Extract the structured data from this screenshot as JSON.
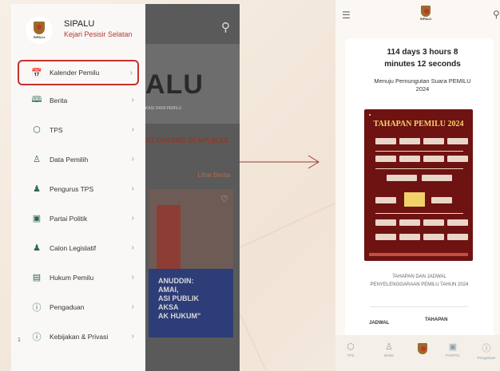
{
  "left_phone": {
    "drawer": {
      "app_name": "SIPALU",
      "subtitle": "Kejari Pesisir Selatan",
      "logo_caption": "SIPALU",
      "items": [
        {
          "label": "Kalender Pemilu",
          "icon": "calendar-icon",
          "glyph": "📅",
          "active": true
        },
        {
          "label": "Berita",
          "icon": "book-icon",
          "glyph": "🕮",
          "active": false
        },
        {
          "label": "TPS",
          "icon": "box-icon",
          "glyph": "⬡",
          "active": false
        },
        {
          "label": "Data Pemilih",
          "icon": "user-icon",
          "glyph": "♙",
          "active": false
        },
        {
          "label": "Pengurus TPS",
          "icon": "person-icon",
          "glyph": "♟",
          "active": false
        },
        {
          "label": "Partai Politik",
          "icon": "portrait-icon",
          "glyph": "▣",
          "active": false
        },
        {
          "label": "Calon Legislatif",
          "icon": "candidate-icon",
          "glyph": "♟",
          "active": false
        },
        {
          "label": "Hukum Pemilu",
          "icon": "law-icon",
          "glyph": "▤",
          "active": false
        },
        {
          "label": "Pengaduan",
          "icon": "shield-icon",
          "glyph": "ⓘ",
          "active": false
        },
        {
          "label": "Kebijakan & Privasi",
          "icon": "privacy-icon",
          "glyph": "ⓘ",
          "active": false
        }
      ]
    },
    "background": {
      "banner_text": "ALU",
      "banner_sub": "KASI DATA PEMILU",
      "welcome": "AT DATANG DI APLIKAS",
      "see_all": "Lihat Berita",
      "quote": "ANUDDIN:\nAMAI,\nASI PUBLIK\nAKSA\nAK HUKUM\"",
      "footer": "1"
    }
  },
  "right_phone": {
    "logo_caption": "SIPALU",
    "countdown": "114 days 3 hours 8 minutes 12 seconds",
    "countdown_desc": "Menuju Pemungutan Suara PEMILU 2024",
    "poster_title": "TAHAPAN PEMILU 2024",
    "poster_caption": "TAHAPAN DAN JADWAL PENYELENGGARAAN PEMILU TAHUN 2024",
    "tab_schedule": "JADWAL",
    "tab_stages": "TAHAPAN",
    "nav": [
      {
        "label": "TPS",
        "icon": "box-icon",
        "glyph": "⬡"
      },
      {
        "label": "Berita",
        "icon": "user-icon",
        "glyph": "♙"
      },
      {
        "label": "PARPOL",
        "icon": "portrait-icon",
        "glyph": "▣"
      },
      {
        "label": "Pengaduan",
        "icon": "shield-icon",
        "glyph": "ⓘ"
      }
    ]
  },
  "colors": {
    "accent_red": "#c8302c",
    "icon_green": "#2d6a4a",
    "poster_red": "#6e1212"
  }
}
